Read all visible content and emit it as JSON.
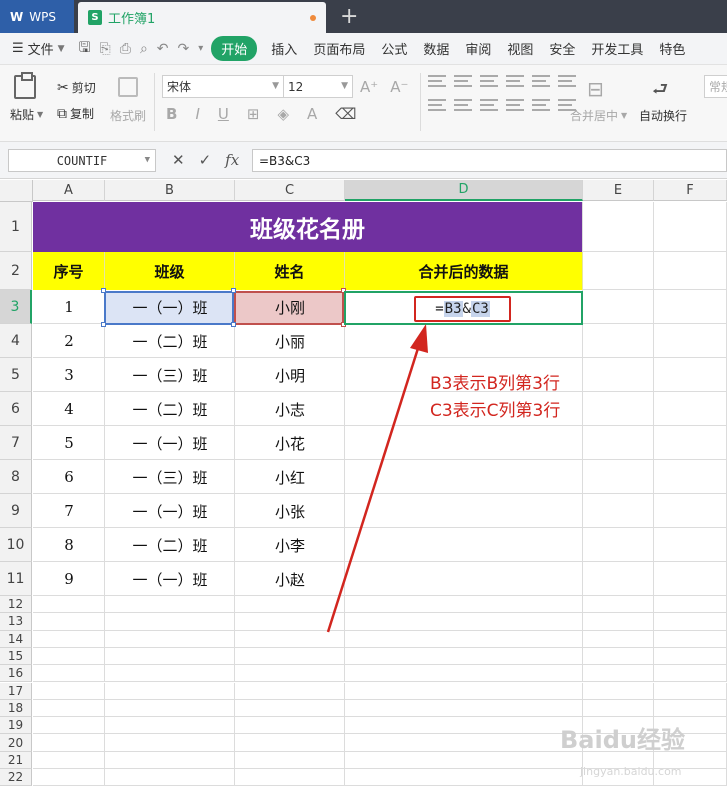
{
  "titlebar": {
    "app_tab": "WPS",
    "doc_tab": "工作簿1"
  },
  "menubar": {
    "file_label": "文件",
    "items": [
      "开始",
      "插入",
      "页面布局",
      "公式",
      "数据",
      "审阅",
      "视图",
      "安全",
      "开发工具",
      "特色"
    ]
  },
  "ribbon": {
    "paste": "粘贴",
    "cut": "剪切",
    "copy": "复制",
    "format_painter": "格式刷",
    "font_name": "宋体",
    "font_size": "12",
    "merge_center": "合并居中",
    "wrap_text": "自动换行",
    "general": "常规"
  },
  "formulabar": {
    "name_box": "COUNTIF",
    "fx": "fx",
    "formula": "=B3&C3"
  },
  "columns": [
    "A",
    "B",
    "C",
    "D",
    "E",
    "F"
  ],
  "rows": [
    "1",
    "2",
    "3",
    "4",
    "5",
    "6",
    "7",
    "8",
    "9",
    "10",
    "11",
    "12",
    "13",
    "14",
    "15",
    "16",
    "17",
    "18",
    "19",
    "20",
    "21",
    "22"
  ],
  "sheet": {
    "title": "班级花名册",
    "headers": [
      "序号",
      "班级",
      "姓名",
      "合并后的数据"
    ],
    "data": [
      [
        "1",
        "一（一）班",
        "小刚"
      ],
      [
        "2",
        "一（二）班",
        "小丽"
      ],
      [
        "3",
        "一（三）班",
        "小明"
      ],
      [
        "4",
        "一（二）班",
        "小志"
      ],
      [
        "5",
        "一（一）班",
        "小花"
      ],
      [
        "6",
        "一（三）班",
        "小红"
      ],
      [
        "7",
        "一（一）班",
        "小张"
      ],
      [
        "8",
        "一（二）班",
        "小李"
      ],
      [
        "9",
        "一（一）班",
        "小赵"
      ]
    ],
    "d3_formula_prefix": "=",
    "d3_formula_ref1": "B3",
    "d3_formula_amp": "&",
    "d3_formula_ref2": "C3"
  },
  "annotation": {
    "line1": "B3表示B列第3行",
    "line2": "C3表示C列第3行",
    "color": "#d2261f"
  },
  "watermark": {
    "text": "Baidu经验",
    "sub": "jingyan.baidu.com"
  },
  "colors": {
    "accent": "#21a366",
    "title_fill": "#7030a0",
    "header_fill": "#ffff00"
  }
}
